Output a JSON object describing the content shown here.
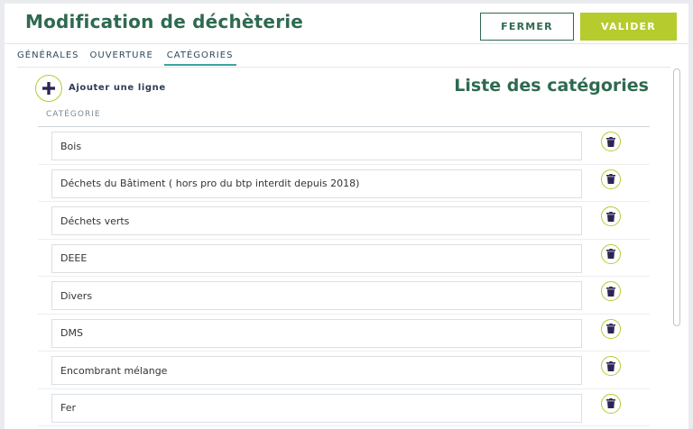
{
  "header": {
    "title": "Modification de déchèterie",
    "close_label": "FERMER",
    "save_label": "VALIDER"
  },
  "tabs": [
    {
      "label": "GÉNÉRALES",
      "active": false
    },
    {
      "label": "OUVERTURE",
      "active": false
    },
    {
      "label": "CATÉGORIES",
      "active": true
    }
  ],
  "categories_panel": {
    "add_label": "Ajouter une ligne",
    "add_icon": "plus-icon",
    "list_title": "Liste des catégories",
    "column_header": "CATÉGORIE",
    "delete_icon": "trash-icon",
    "rows": [
      "Bois",
      "Déchets du Bâtiment ( hors pro du btp interdit depuis 2018)",
      "Déchets verts",
      "DEEE",
      "Divers",
      "DMS",
      "Encombrant mélange",
      "Fer"
    ]
  },
  "colors": {
    "primary_green": "#2e6a4f",
    "accent_lime": "#b5cb2e",
    "tab_underline": "#3aa6a0",
    "icon_dark": "#2e2552"
  }
}
